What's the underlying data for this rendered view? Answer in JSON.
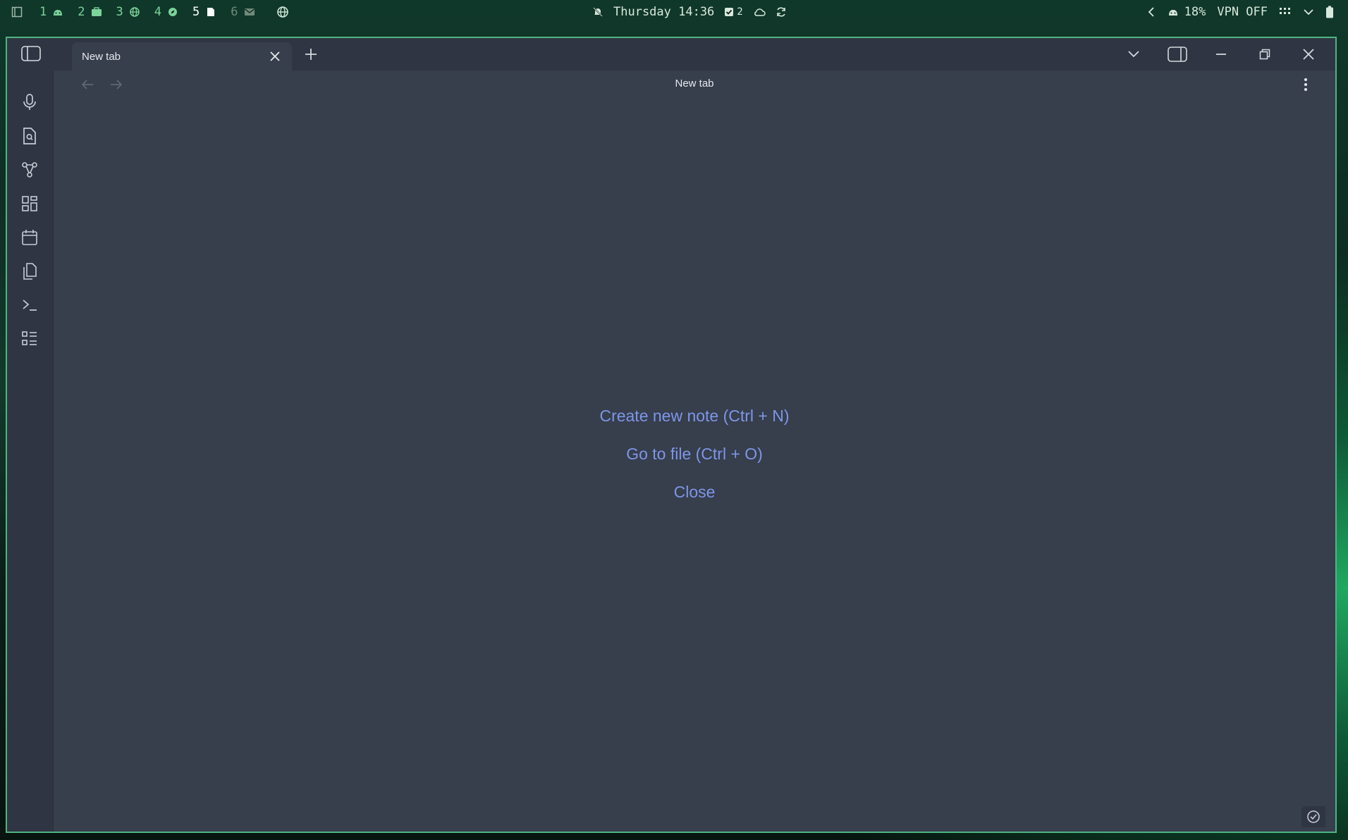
{
  "topbar": {
    "workspaces": [
      {
        "num": "1",
        "icon": "android-icon"
      },
      {
        "num": "2",
        "icon": "briefcase-icon"
      },
      {
        "num": "3",
        "icon": "globe-icon"
      },
      {
        "num": "4",
        "icon": "compass-icon"
      },
      {
        "num": "5",
        "icon": "note-icon"
      },
      {
        "num": "6",
        "icon": "mail-icon"
      }
    ],
    "active_workspace": "5",
    "clock": "Thursday 14:36",
    "tasks_count": "2",
    "battery_percent": "18%",
    "vpn_status": "VPN OFF"
  },
  "window": {
    "tab_title": "New tab",
    "view_title": "New tab",
    "accent_color": "#7d96e8",
    "border_color": "#4fb483"
  },
  "ribbon": {
    "items": [
      "microphone-icon",
      "file-search-icon",
      "graph-icon",
      "dashboard-icon",
      "calendar-icon",
      "copy-icon",
      "terminal-icon",
      "list-icon"
    ]
  },
  "empty_state": {
    "create_note": "Create new note (Ctrl + N)",
    "go_to_file": "Go to file (Ctrl + O)",
    "close": "Close"
  }
}
